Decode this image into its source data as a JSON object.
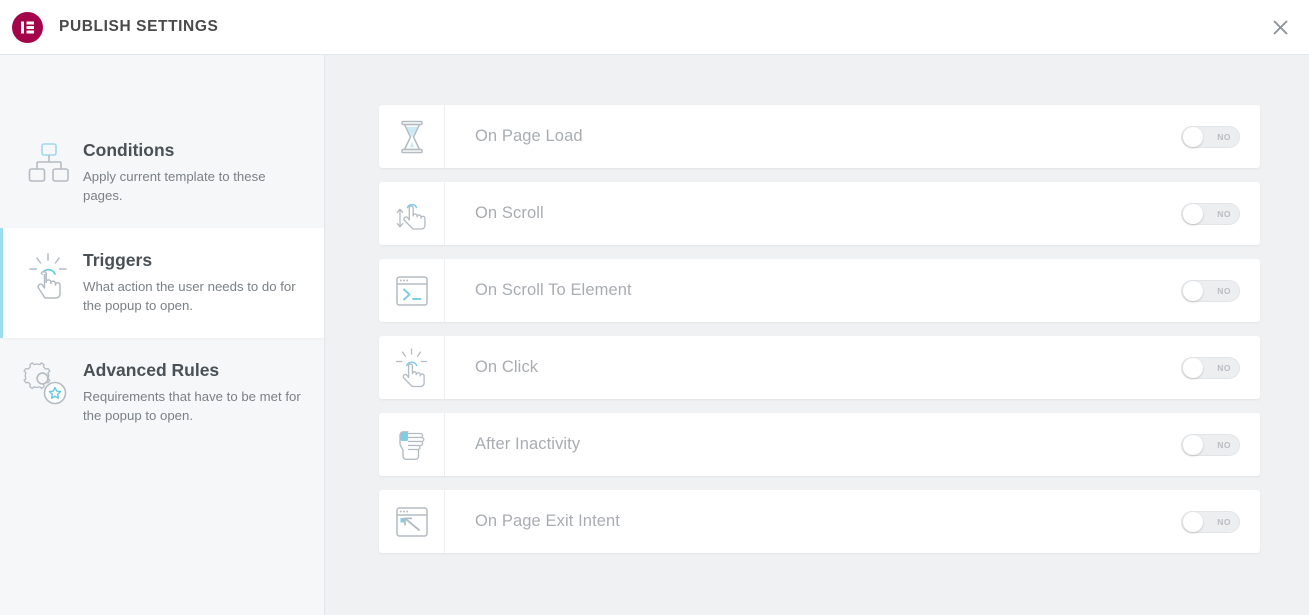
{
  "header": {
    "title": "PUBLISH SETTINGS",
    "logo_icon": "elementor-logo-icon",
    "close_icon": "close-icon",
    "logo_color": "#a4054a",
    "title_color": "#4a4a4a"
  },
  "sidebar": {
    "items": [
      {
        "id": "conditions",
        "icon": "sitemap-icon",
        "title": "Conditions",
        "description": "Apply current template to these pages.",
        "active": false
      },
      {
        "id": "triggers",
        "icon": "click-hand-icon",
        "title": "Triggers",
        "description": "What action the user needs to do for the popup to open.",
        "active": true
      },
      {
        "id": "advanced-rules",
        "icon": "gear-star-icon",
        "title": "Advanced Rules",
        "description": "Requirements that have to be met for the popup to open.",
        "active": false
      }
    ],
    "active_accent_color": "#9fdcf0"
  },
  "main": {
    "triggers": [
      {
        "id": "on-page-load",
        "icon": "hourglass-icon",
        "label": "On Page Load",
        "toggle_label": "NO",
        "toggle_on": false
      },
      {
        "id": "on-scroll",
        "icon": "scroll-hand-icon",
        "label": "On Scroll",
        "toggle_label": "NO",
        "toggle_on": false
      },
      {
        "id": "on-scroll-to-element",
        "icon": "window-prompt-icon",
        "label": "On Scroll To Element",
        "toggle_label": "NO",
        "toggle_on": false
      },
      {
        "id": "on-click",
        "icon": "click-hand-icon",
        "label": "On Click",
        "toggle_label": "NO",
        "toggle_on": false
      },
      {
        "id": "after-inactivity",
        "icon": "idle-hand-icon",
        "label": "After Inactivity",
        "toggle_label": "NO",
        "toggle_on": false
      },
      {
        "id": "on-page-exit-intent",
        "icon": "window-exit-arrow-icon",
        "label": "On Page Exit Intent",
        "toggle_label": "NO",
        "toggle_on": false
      }
    ],
    "label_color": "#a9adb2",
    "icon_accent_color": "#9fd8ee",
    "icon_stroke_color": "#b4bcc3"
  }
}
